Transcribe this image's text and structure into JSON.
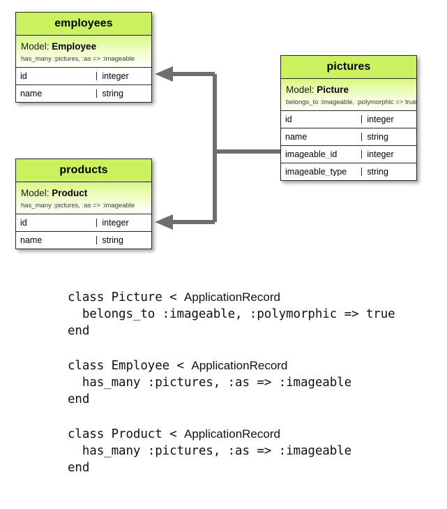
{
  "diagram": {
    "title": "Polymorphic association ER diagram",
    "colors": {
      "entity_header": "#c9f25e",
      "entity_model_top": "#d8f77f",
      "entity_model_bottom": "#fdfff7",
      "border": "#262626",
      "connector": "#6e6e6e",
      "background": "#ffffff"
    },
    "entities": [
      {
        "id": "employees",
        "title": "employees",
        "model_label": "Model:",
        "model_name": "Employee",
        "model_sub": "has_many :pictures, :as => :imageable",
        "rows": [
          {
            "name": "id",
            "type": "integer"
          },
          {
            "name": "name",
            "type": "string"
          }
        ]
      },
      {
        "id": "products",
        "title": "products",
        "model_label": "Model:",
        "model_name": "Product",
        "model_sub": "has_many :pictures, :as => :imageable",
        "rows": [
          {
            "name": "id",
            "type": "integer"
          },
          {
            "name": "name",
            "type": "string"
          }
        ]
      },
      {
        "id": "pictures",
        "title": "pictures",
        "model_label": "Model:",
        "model_name": "Picture",
        "model_sub": "belongs_to :imageable, :polymorphic => true",
        "rows": [
          {
            "name": "id",
            "type": "integer"
          },
          {
            "name": "name",
            "type": "string"
          },
          {
            "name": "imageable_id",
            "type": "integer"
          },
          {
            "name": "imageable_type",
            "type": "string"
          }
        ]
      }
    ],
    "relationships": [
      {
        "from": "pictures.imageable_id",
        "to": "employees",
        "style": "arrow"
      },
      {
        "from": "pictures.imageable_id",
        "to": "products",
        "style": "arrow"
      }
    ]
  },
  "code": {
    "blocks": [
      {
        "id": "picture-class",
        "lines": [
          {
            "pre": "class Picture < ",
            "cls": "ApplicationRecord",
            "post": ""
          },
          {
            "pre": "  belongs_to :imageable, :polymorphic => true",
            "cls": "",
            "post": ""
          },
          {
            "pre": "end",
            "cls": "",
            "post": ""
          }
        ]
      },
      {
        "id": "employee-class",
        "lines": [
          {
            "pre": "class Employee < ",
            "cls": "ApplicationRecord",
            "post": ""
          },
          {
            "pre": "  has_many :pictures, :as => :imageable",
            "cls": "",
            "post": ""
          },
          {
            "pre": "end",
            "cls": "",
            "post": ""
          }
        ]
      },
      {
        "id": "product-class",
        "lines": [
          {
            "pre": "class Product < ",
            "cls": "ApplicationRecord",
            "post": ""
          },
          {
            "pre": "  has_many :pictures, :as => :imageable",
            "cls": "",
            "post": ""
          },
          {
            "pre": "end",
            "cls": "",
            "post": ""
          }
        ]
      }
    ]
  }
}
